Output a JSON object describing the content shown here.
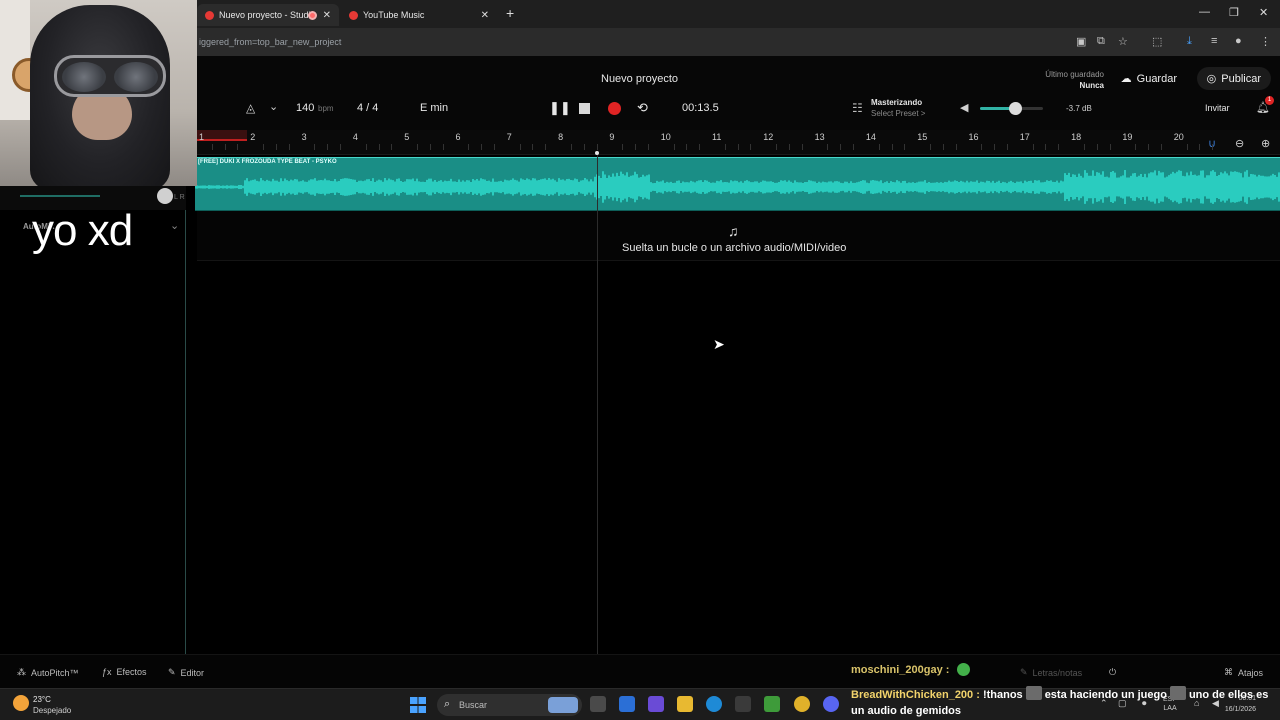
{
  "browser": {
    "tabs": [
      {
        "label": "Nuevo proyecto - Studio",
        "active": true
      },
      {
        "label": "YouTube Music",
        "active": false
      }
    ],
    "url": "iggered_from=top_bar_new_project"
  },
  "overlay": {
    "caption": "yo xd"
  },
  "studio": {
    "project_title": "Nuevo proyecto",
    "last_saved_label": "Último guardado",
    "last_saved_value": "Nunca",
    "save_label": "Guardar",
    "publish_label": "Publicar",
    "bpm": "140",
    "bpm_unit": "bpm",
    "time_signature": "4 / 4",
    "key": "E min",
    "timecode": "00:13.5",
    "mastering_title": "Masterizando",
    "mastering_preset": "Select Preset >",
    "volume_db": "-3.7 dB",
    "volume_level": 0.55,
    "invite_label": "Invitar",
    "notifications_count": "1",
    "track_panel_label": "AutoMix",
    "ruler_numbers": [
      "1",
      "2",
      "3",
      "4",
      "5",
      "6",
      "7",
      "8",
      "9",
      "10",
      "11",
      "12",
      "13",
      "14",
      "15",
      "16",
      "17",
      "18",
      "19",
      "20"
    ],
    "track_name": "[FREE] DUKI X FROZOUDA TYPE BEAT - PSYKO",
    "drop_zone_text": "Suelta un bucle o un archivo audio/MIDI/video"
  },
  "bottom_bar": {
    "autopitch": "AutoPitch™",
    "effects": "Efectos",
    "editor": "Editor",
    "notes": "Letras/notas",
    "shortcuts": "Atajos"
  },
  "chat": {
    "message1_user": "moschini_200gay :",
    "message2_user": "BreadWithChicken_200 :",
    "message2_text_a": "!thanos",
    "message2_text_b": "esta haciendo un juego",
    "message2_text_c": "uno de ellos es un audio de gemidos"
  },
  "taskbar": {
    "temperature": "23°C",
    "weather": "Despejado",
    "search_placeholder": "Buscar",
    "language": "ESP",
    "language_sub": "LAA",
    "time": "00:01",
    "date": "16/1/2026"
  },
  "colors": {
    "accent": "#1a8e86",
    "waveform": "#2fe0d2",
    "record": "#e02424"
  }
}
